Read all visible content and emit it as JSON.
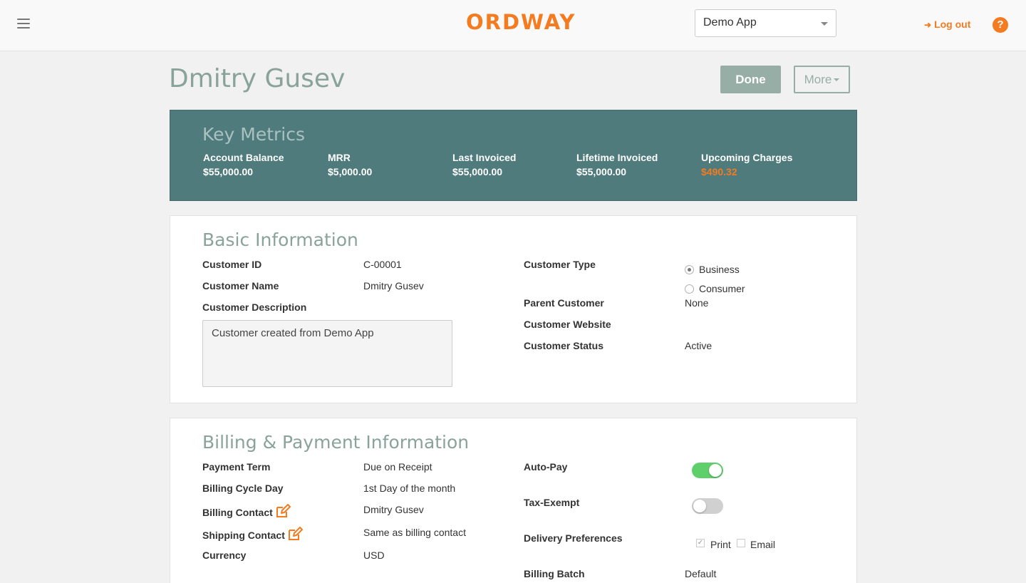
{
  "header": {
    "logo_text": "ORDWAY",
    "app_select": "Demo App",
    "logout_label": "Log out",
    "help_label": "?"
  },
  "page": {
    "title": "Dmitry Gusev",
    "done_label": "Done",
    "more_label": "More"
  },
  "key_metrics": {
    "title": "Key Metrics",
    "items": [
      {
        "label": "Account Balance",
        "value": "$55,000.00"
      },
      {
        "label": "MRR",
        "value": "$5,000.00"
      },
      {
        "label": "Last Invoiced",
        "value": "$55,000.00"
      },
      {
        "label": "Lifetime Invoiced",
        "value": "$55,000.00"
      },
      {
        "label": "Upcoming Charges",
        "value": "$490.32"
      }
    ],
    "highlight_color": "#f47b20"
  },
  "basic_info": {
    "title": "Basic Information",
    "customer_id_label": "Customer ID",
    "customer_id": "C-00001",
    "customer_name_label": "Customer Name",
    "customer_name": "Dmitry Gusev",
    "description_label": "Customer Description",
    "description": "Customer created from Demo App",
    "customer_type_label": "Customer Type",
    "type_options": [
      "Business",
      "Consumer"
    ],
    "type_selected": "Business",
    "parent_customer_label": "Parent Customer",
    "parent_customer": "None",
    "website_label": "Customer Website",
    "website": "",
    "status_label": "Customer Status",
    "status": "Active"
  },
  "billing_info": {
    "title": "Billing & Payment Information",
    "payment_term_label": "Payment Term",
    "payment_term": "Due on Receipt",
    "billing_cycle_label": "Billing Cycle Day",
    "billing_cycle": "1st Day of the month",
    "billing_contact_label": "Billing Contact",
    "billing_contact": "Dmitry Gusev",
    "shipping_contact_label": "Shipping Contact",
    "shipping_contact": "Same as billing contact",
    "currency_label": "Currency",
    "currency": "USD",
    "autopay_label": "Auto-Pay",
    "autopay_on": true,
    "tax_exempt_label": "Tax-Exempt",
    "tax_exempt_on": false,
    "delivery_label": "Delivery Preferences",
    "delivery_print": "Print",
    "delivery_email": "Email",
    "print_checked": true,
    "email_checked": false,
    "billing_batch_label": "Billing Batch",
    "billing_batch": "Default"
  },
  "colors": {
    "brand_orange": "#f47b20",
    "metrics_bg": "#4f7b7d",
    "title_green": "#8aa39a",
    "toggle_on": "#5fcf6b"
  }
}
